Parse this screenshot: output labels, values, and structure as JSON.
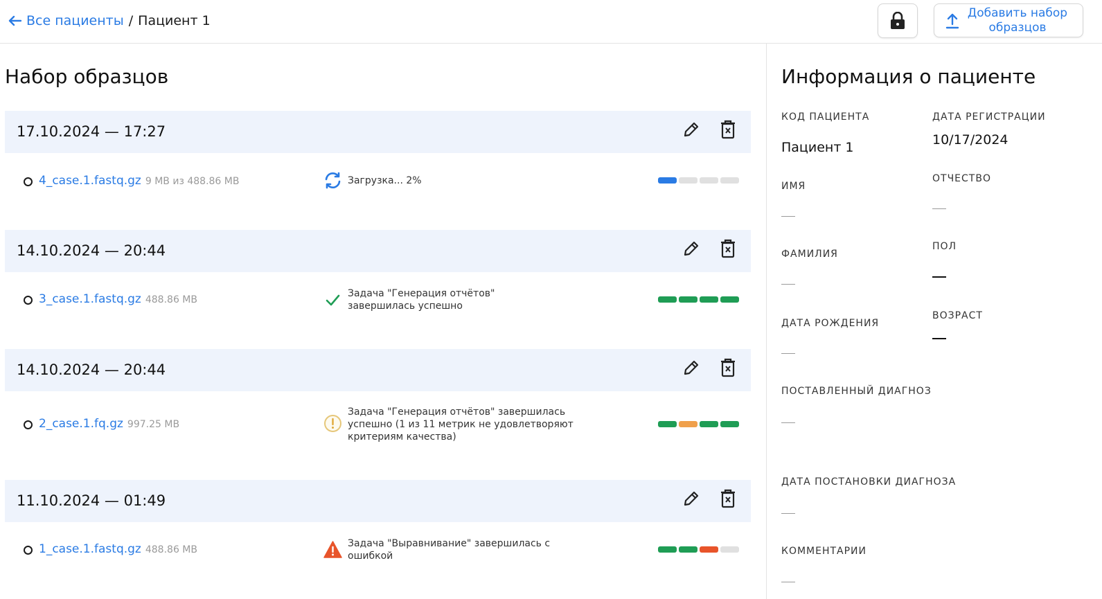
{
  "breadcrumb": {
    "back_label": "Все пациенты",
    "separator": "/",
    "current": "Пациент 1"
  },
  "header": {
    "lock_icon": "lock-icon",
    "add_button_label": "Добавить набор образцов",
    "add_button_icon": "upload-icon"
  },
  "samples": {
    "title": "Набор образцов",
    "sets": [
      {
        "date": "17.10.2024 — 17:27",
        "file": {
          "name": "4_case.1.fastq.gz",
          "size": "9 MB из 488.86 MB",
          "status_icon": "sync-icon",
          "status": "Загрузка... 2%",
          "progress": [
            "blue",
            "gray",
            "gray",
            "gray"
          ]
        }
      },
      {
        "date": "14.10.2024 — 20:44",
        "file": {
          "name": "3_case.1.fastq.gz",
          "size": "488.86 MB",
          "status_icon": "check-icon",
          "status": "Задача \"Генерация отчётов\" завершилась успешно",
          "progress": [
            "green",
            "green",
            "green",
            "green"
          ]
        }
      },
      {
        "date": "14.10.2024 — 20:44",
        "file": {
          "name": "2_case.1.fq.gz",
          "size": "997.25 MB",
          "status_icon": "warning-circle-icon",
          "status": "Задача \"Генерация отчётов\" завершилась успешно (1 из 11 метрик не удовлетворяют критериям качества)",
          "progress": [
            "green",
            "orange",
            "green",
            "green"
          ]
        }
      },
      {
        "date": "11.10.2024 — 01:49",
        "file": {
          "name": "1_case.1.fastq.gz",
          "size": "488.86 MB",
          "status_icon": "error-triangle-icon",
          "status": "Задача \"Выравнивание\" завершилась с ошибкой",
          "progress": [
            "green",
            "green",
            "red",
            "gray"
          ]
        }
      }
    ]
  },
  "patient": {
    "title": "Информация о пациенте",
    "code_label": "КОД ПАЦИЕНТА",
    "code_value": "Пациент 1",
    "reg_date_label": "ДАТА РЕГИСТРАЦИИ",
    "reg_date_value": "10/17/2024",
    "first_name_label": "ИМЯ",
    "patronymic_label": "ОТЧЕСТВО",
    "last_name_label": "ФАМИЛИЯ",
    "sex_label": "ПОЛ",
    "birth_date_label": "ДАТА РОЖДЕНИЯ",
    "age_label": "ВОЗРАСТ",
    "diagnosis_label": "ПОСТАВЛЕННЫЙ ДИАГНОЗ",
    "diagnosis_date_label": "ДАТА ПОСТАНОВКИ ДИАГНОЗА",
    "comments_label": "КОММЕНТАРИИ"
  },
  "colors": {
    "accent": "#2a7be4",
    "header_bg": "#eef3fc",
    "green": "#1f9d55",
    "orange": "#f0a04b",
    "red": "#e8542a",
    "gray": "#e0e0e0",
    "blue": "#2a7be4"
  }
}
